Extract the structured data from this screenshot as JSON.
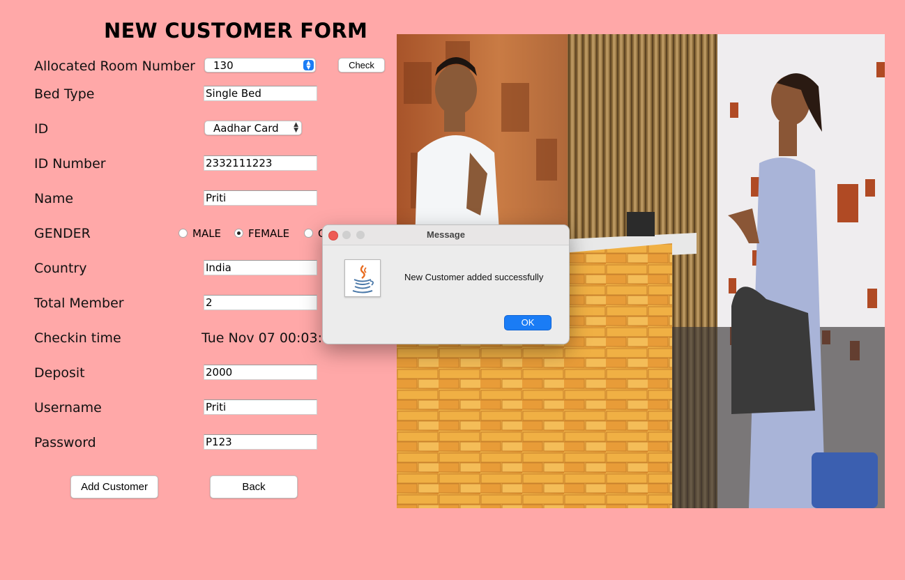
{
  "form": {
    "title": "NEW CUSTOMER FORM",
    "labels": {
      "room": "Allocated Room Number",
      "bed": "Bed Type",
      "id": "ID",
      "id_number": "ID Number",
      "name": "Name",
      "gender": "GENDER",
      "country": "Country",
      "total_member": "Total Member",
      "checkin": "Checkin time",
      "deposit": "Deposit",
      "username": "Username",
      "password": "Password"
    },
    "room_number": "130",
    "check_button": "Check",
    "bed_type": "Single Bed",
    "id_type": "Aadhar Card",
    "id_number": "2332111223",
    "name": "Priti",
    "gender_options": [
      "MALE",
      "FEMALE",
      "O"
    ],
    "gender_selected": "FEMALE",
    "country": "India",
    "total_member": "2",
    "checkin_time": "Tue Nov 07 00:03:4",
    "deposit": "2000",
    "username": "Priti",
    "password": "P123",
    "add_button": "Add Customer",
    "back_button": "Back"
  },
  "dialog": {
    "title": "Message",
    "message": "New Customer added successfully",
    "ok_label": "OK",
    "icon": "java-icon"
  },
  "colors": {
    "background": "#ffa8a8",
    "accent": "#1a7cf5"
  }
}
